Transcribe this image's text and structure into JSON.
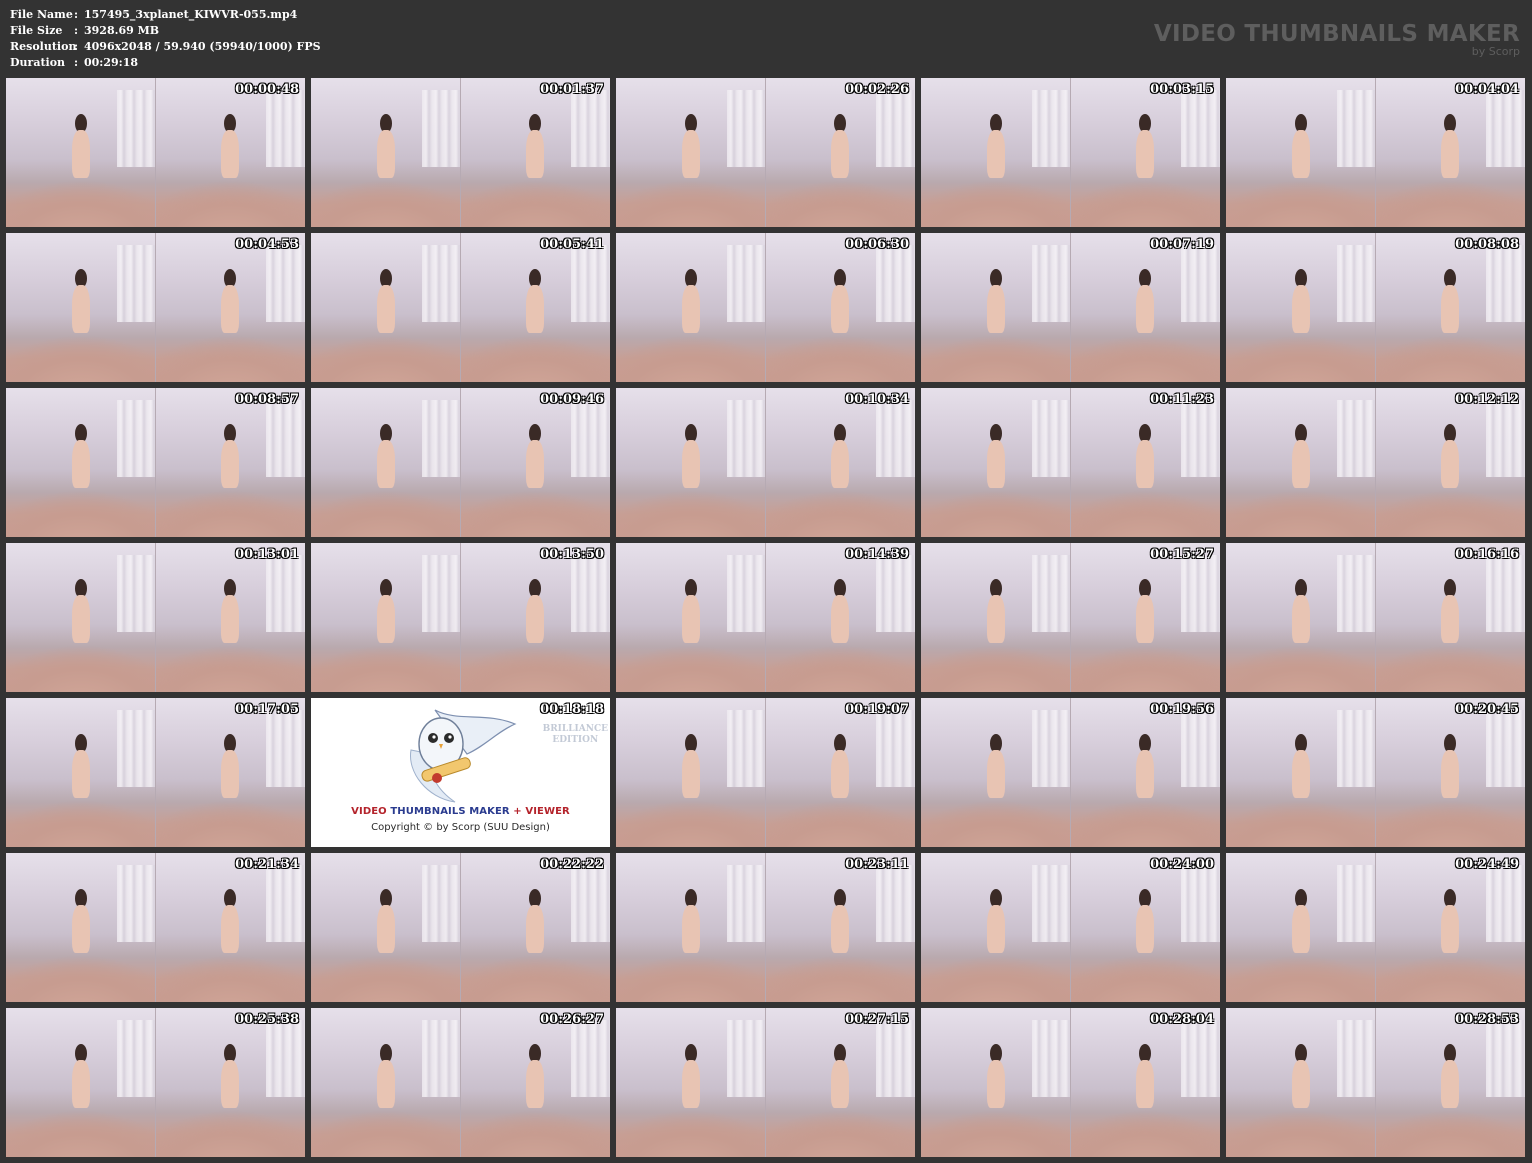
{
  "file_info": [
    {
      "label": "File Name",
      "value": "157495_3xplanet_KIWVR-055.mp4"
    },
    {
      "label": "File Size",
      "value": "3928.69 MB"
    },
    {
      "label": "Resolution",
      "value": "4096x2048 / 59.940 (59940/1000) FPS"
    },
    {
      "label": "Duration",
      "value": "00:29:18"
    }
  ],
  "separator": ":",
  "brand": {
    "title": "VIDEO THUMBNAILS MAKER",
    "subtitle": "by Scorp"
  },
  "logo": {
    "title_part1": "VIDEO",
    "title_part2": "THUMBNAILS MAKER",
    "title_part3": "+ VIEWER",
    "copyright": "Copyright © by Scorp (SUU Design)",
    "edition_line1": "BRILLIANCE",
    "edition_line2": "EDITION",
    "icon": "owl-scroll-icon"
  },
  "thumbnails": [
    "00:00:48",
    "00:01:37",
    "00:02:26",
    "00:03:15",
    "00:04:04",
    "00:04:53",
    "00:05:41",
    "00:06:30",
    "00:07:19",
    "00:08:08",
    "00:08:57",
    "00:09:46",
    "00:10:34",
    "00:11:23",
    "00:12:12",
    "00:13:01",
    "00:13:50",
    "00:14:39",
    "00:15:27",
    "00:16:16",
    "00:17:05",
    "00:18:18",
    "00:19:07",
    "00:19:56",
    "00:20:45",
    "00:21:34",
    "00:22:22",
    "00:23:11",
    "00:24:00",
    "00:24:49",
    "00:25:38",
    "00:26:27",
    "00:27:15",
    "00:28:04",
    "00:28:53"
  ],
  "logo_tile_index": 21
}
